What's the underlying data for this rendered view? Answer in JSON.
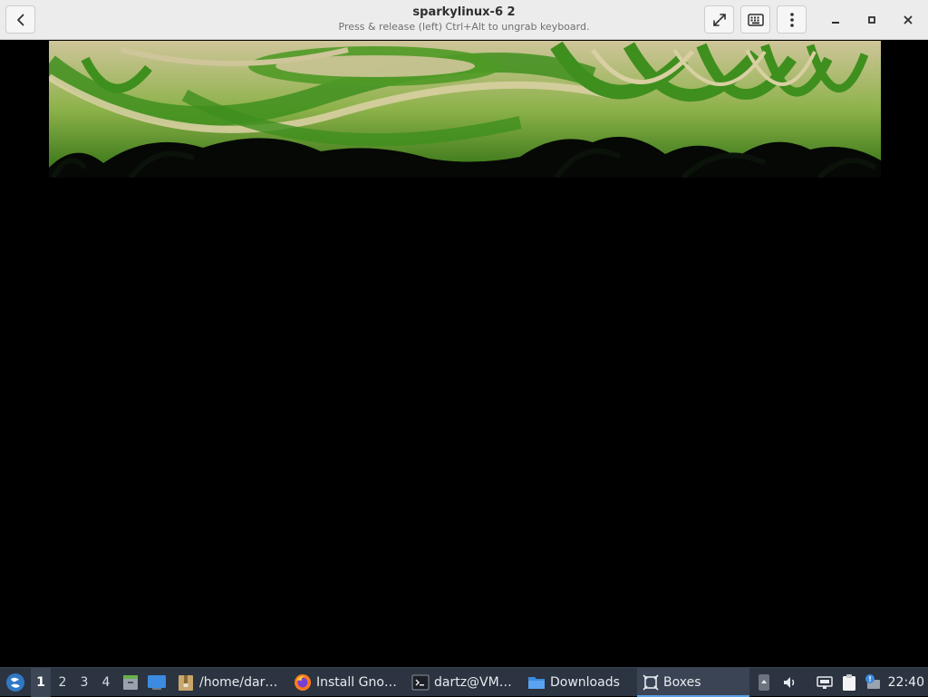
{
  "window": {
    "title": "sparkylinux-6 2",
    "subtitle": "Press & release (left) Ctrl+Alt to ungrab keyboard."
  },
  "header_buttons": {
    "back": "back-icon",
    "fullscreen": "fullscreen-icon",
    "keyboard": "keyboard-icon",
    "menu": "kebab-menu-icon",
    "minimize": "minimize-icon",
    "maximize": "maximize-icon",
    "close": "close-icon"
  },
  "taskbar": {
    "workspaces": [
      "1",
      "2",
      "3",
      "4"
    ],
    "active_workspace": "1",
    "tasks": [
      {
        "label": "/home/dar…",
        "icon": "archive-icon"
      },
      {
        "label": "Install Gno…",
        "icon": "firefox-icon"
      },
      {
        "label": "dartz@VM…",
        "icon": "terminal-icon"
      },
      {
        "label": "Downloads",
        "icon": "folder-icon"
      },
      {
        "label": "Boxes",
        "icon": "boxes-icon",
        "active": true
      }
    ],
    "clock": "22:40"
  },
  "colors": {
    "headerbar": "#ececec",
    "taskbar": "#2b3440",
    "accent": "#5aa0e6",
    "wallpaper_green": "#3f8f1e",
    "wallpaper_beige": "#cfc59a"
  }
}
